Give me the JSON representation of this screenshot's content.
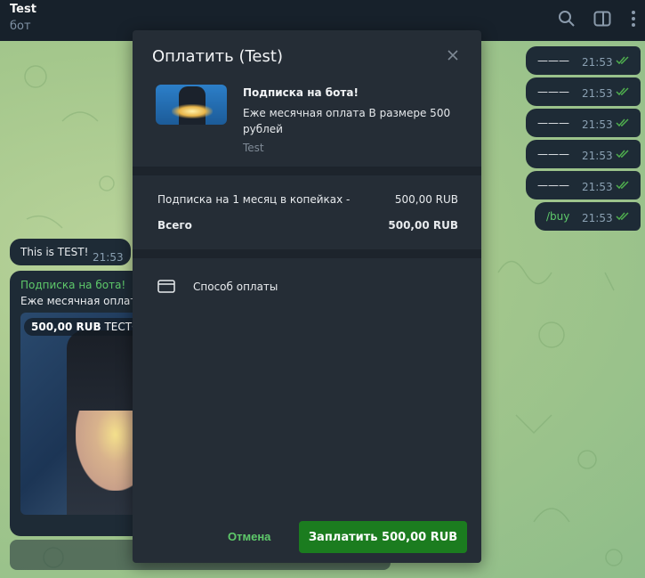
{
  "header": {
    "title": "Test",
    "subtitle": "бот"
  },
  "outgoing": [
    {
      "text": "———",
      "time": "21:53"
    },
    {
      "text": "———",
      "time": "21:53"
    },
    {
      "text": "———",
      "time": "21:53"
    },
    {
      "text": "———",
      "time": "21:53"
    },
    {
      "text": "———",
      "time": "21:53"
    },
    {
      "text": "/buy",
      "time": "21:53"
    }
  ],
  "incoming_text": {
    "text": "This is TEST!",
    "time": "21:53"
  },
  "invoice_message": {
    "title": "Подписка на бота!",
    "desc_truncated": "Еже месячная оплат",
    "price_badge": "500,00 RUB",
    "badge_suffix": "ТЕСТОВ"
  },
  "dialog": {
    "title": "Оплатить (Test)",
    "product_title": "Подписка на бота!",
    "product_desc": "Еже месячная оплата В размере 500 рублей",
    "bot_name": "Test",
    "line_item_label": "Подписка на 1 месяц в копейках -",
    "line_item_value": "500,00 RUB",
    "total_label": "Всего",
    "total_value": "500,00 RUB",
    "payment_method": "Способ оплаты",
    "cancel": "Отмена",
    "pay": "Заплатить 500,00 RUB"
  },
  "colors": {
    "accent_green": "#1b7c1f",
    "link_green": "#5ec96a",
    "check": "#4fae4e"
  }
}
